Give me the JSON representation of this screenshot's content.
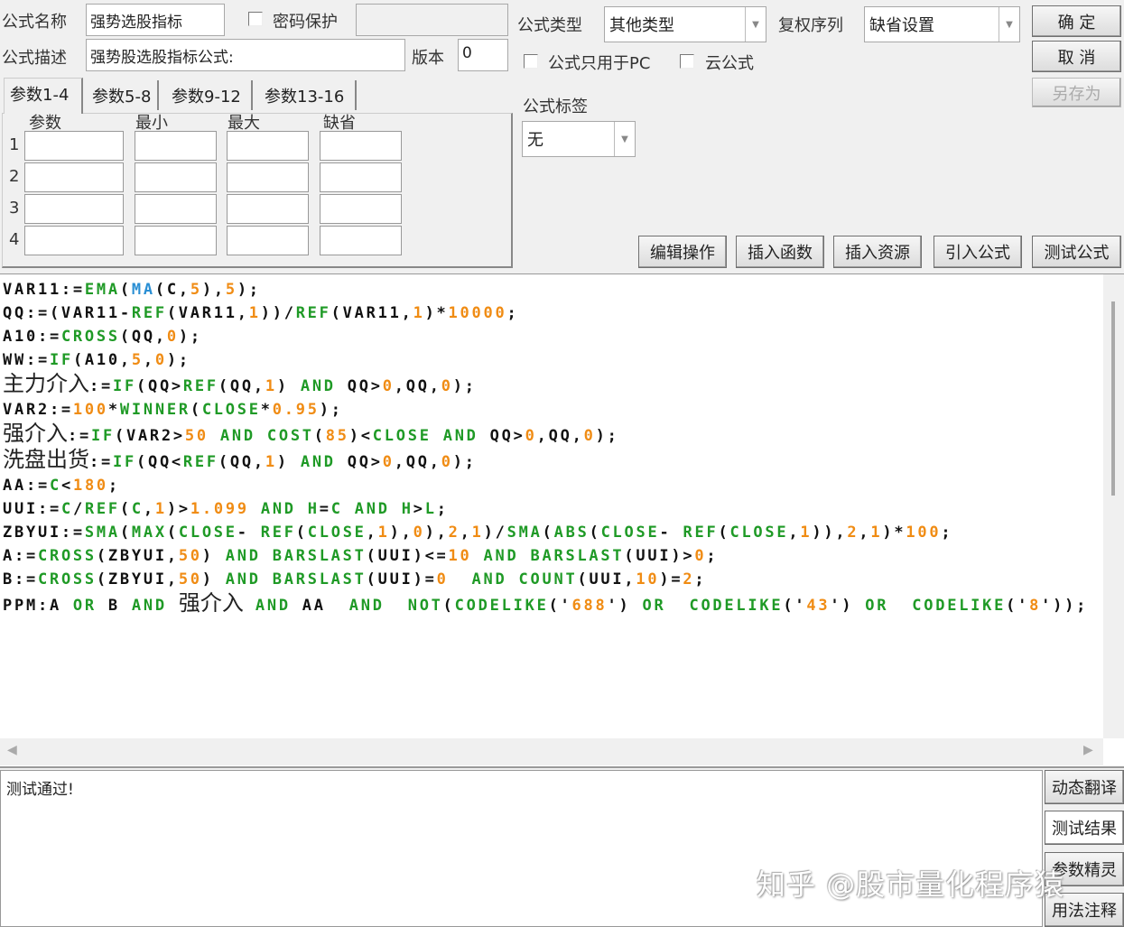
{
  "form": {
    "name_label": "公式名称",
    "name_value": "强势选股指标",
    "password_label": "密码保护",
    "desc_label": "公式描述",
    "desc_value": "强势股选股指标公式:",
    "version_label": "版本",
    "version_value": "0",
    "type_label": "公式类型",
    "type_value": "其他类型",
    "rights_label": "复权序列",
    "rights_value": "缺省设置",
    "pc_only_label": "公式只用于PC",
    "cloud_label": "云公式",
    "tag_label": "公式标签",
    "tag_value": "无"
  },
  "buttons": {
    "ok": "确 定",
    "cancel": "取 消",
    "save_as": "另存为",
    "edit": "编辑操作",
    "insert_func": "插入函数",
    "insert_res": "插入资源",
    "import": "引入公式",
    "test": "测试公式"
  },
  "tabs": [
    "参数1-4",
    "参数5-8",
    "参数9-12",
    "参数13-16"
  ],
  "params": {
    "headers": [
      "参数",
      "最小",
      "最大",
      "缺省"
    ],
    "rows": [
      "1",
      "2",
      "3",
      "4"
    ]
  },
  "code": [
    [
      [
        "VAR11:=",
        "k"
      ],
      [
        "EMA",
        "g"
      ],
      [
        "(",
        "k"
      ],
      [
        "MA",
        "b"
      ],
      [
        "(C,",
        "k"
      ],
      [
        "5",
        "o"
      ],
      [
        "),",
        "k"
      ],
      [
        "5",
        "o"
      ],
      [
        ");",
        "k"
      ]
    ],
    [
      [
        "QQ:=(VAR11-",
        "k"
      ],
      [
        "REF",
        "g"
      ],
      [
        "(VAR11,",
        "k"
      ],
      [
        "1",
        "o"
      ],
      [
        "))/",
        "k"
      ],
      [
        "REF",
        "g"
      ],
      [
        "(VAR11,",
        "k"
      ],
      [
        "1",
        "o"
      ],
      [
        ")*",
        "k"
      ],
      [
        "10000",
        "o"
      ],
      [
        ";",
        "k"
      ]
    ],
    [
      [
        "A10:=",
        "k"
      ],
      [
        "CROSS",
        "g"
      ],
      [
        "(QQ,",
        "k"
      ],
      [
        "0",
        "o"
      ],
      [
        ");",
        "k"
      ]
    ],
    [
      [
        "WW:=",
        "k"
      ],
      [
        "IF",
        "g"
      ],
      [
        "(A10,",
        "k"
      ],
      [
        "5",
        "o"
      ],
      [
        ",",
        "k"
      ],
      [
        "0",
        "o"
      ],
      [
        ");",
        "k"
      ]
    ],
    [
      [
        "主力介入",
        "z"
      ],
      [
        ":=",
        "k"
      ],
      [
        "IF",
        "g"
      ],
      [
        "(QQ>",
        "k"
      ],
      [
        "REF",
        "g"
      ],
      [
        "(QQ,",
        "k"
      ],
      [
        "1",
        "o"
      ],
      [
        ") ",
        "k"
      ],
      [
        "AND",
        "g"
      ],
      [
        " QQ>",
        "k"
      ],
      [
        "0",
        "o"
      ],
      [
        ",QQ,",
        "k"
      ],
      [
        "0",
        "o"
      ],
      [
        ");",
        "k"
      ]
    ],
    [
      [
        "VAR2:=",
        "k"
      ],
      [
        "100",
        "o"
      ],
      [
        "*",
        "k"
      ],
      [
        "WINNER",
        "g"
      ],
      [
        "(",
        "k"
      ],
      [
        "CLOSE",
        "g"
      ],
      [
        "*",
        "k"
      ],
      [
        "0.95",
        "o"
      ],
      [
        ");",
        "k"
      ]
    ],
    [
      [
        "强介入",
        "z"
      ],
      [
        ":=",
        "k"
      ],
      [
        "IF",
        "g"
      ],
      [
        "(VAR2>",
        "k"
      ],
      [
        "50",
        "o"
      ],
      [
        " ",
        "k"
      ],
      [
        "AND",
        "g"
      ],
      [
        " ",
        "k"
      ],
      [
        "COST",
        "g"
      ],
      [
        "(",
        "k"
      ],
      [
        "85",
        "o"
      ],
      [
        ")<",
        "k"
      ],
      [
        "CLOSE",
        "g"
      ],
      [
        " ",
        "k"
      ],
      [
        "AND",
        "g"
      ],
      [
        " QQ>",
        "k"
      ],
      [
        "0",
        "o"
      ],
      [
        ",QQ,",
        "k"
      ],
      [
        "0",
        "o"
      ],
      [
        ");",
        "k"
      ]
    ],
    [
      [
        "洗盘出货",
        "z"
      ],
      [
        ":=",
        "k"
      ],
      [
        "IF",
        "g"
      ],
      [
        "(QQ<",
        "k"
      ],
      [
        "REF",
        "g"
      ],
      [
        "(QQ,",
        "k"
      ],
      [
        "1",
        "o"
      ],
      [
        ") ",
        "k"
      ],
      [
        "AND",
        "g"
      ],
      [
        " QQ>",
        "k"
      ],
      [
        "0",
        "o"
      ],
      [
        ",QQ,",
        "k"
      ],
      [
        "0",
        "o"
      ],
      [
        ");",
        "k"
      ]
    ],
    [
      [
        "AA:=",
        "k"
      ],
      [
        "C",
        "g"
      ],
      [
        "<",
        "k"
      ],
      [
        "180",
        "o"
      ],
      [
        ";",
        "k"
      ]
    ],
    [
      [
        "UUI:=",
        "k"
      ],
      [
        "C",
        "g"
      ],
      [
        "/",
        "k"
      ],
      [
        "REF",
        "g"
      ],
      [
        "(",
        "k"
      ],
      [
        "C",
        "g"
      ],
      [
        ",",
        "k"
      ],
      [
        "1",
        "o"
      ],
      [
        ")>",
        "k"
      ],
      [
        "1.099",
        "o"
      ],
      [
        " ",
        "k"
      ],
      [
        "AND",
        "g"
      ],
      [
        " ",
        "k"
      ],
      [
        "H",
        "g"
      ],
      [
        "=",
        "k"
      ],
      [
        "C",
        "g"
      ],
      [
        " ",
        "k"
      ],
      [
        "AND",
        "g"
      ],
      [
        " ",
        "k"
      ],
      [
        "H",
        "g"
      ],
      [
        ">",
        "k"
      ],
      [
        "L",
        "g"
      ],
      [
        ";",
        "k"
      ]
    ],
    [
      [
        "ZBYUI:=",
        "k"
      ],
      [
        "SMA",
        "g"
      ],
      [
        "(",
        "k"
      ],
      [
        "MAX",
        "g"
      ],
      [
        "(",
        "k"
      ],
      [
        "CLOSE",
        "g"
      ],
      [
        "- ",
        "k"
      ],
      [
        "REF",
        "g"
      ],
      [
        "(",
        "k"
      ],
      [
        "CLOSE",
        "g"
      ],
      [
        ",",
        "k"
      ],
      [
        "1",
        "o"
      ],
      [
        "),",
        "k"
      ],
      [
        "0",
        "o"
      ],
      [
        "),",
        "k"
      ],
      [
        "2",
        "o"
      ],
      [
        ",",
        "k"
      ],
      [
        "1",
        "o"
      ],
      [
        ")/",
        "k"
      ],
      [
        "SMA",
        "g"
      ],
      [
        "(",
        "k"
      ],
      [
        "ABS",
        "g"
      ],
      [
        "(",
        "k"
      ],
      [
        "CLOSE",
        "g"
      ],
      [
        "- ",
        "k"
      ],
      [
        "REF",
        "g"
      ],
      [
        "(",
        "k"
      ],
      [
        "CLOSE",
        "g"
      ],
      [
        ",",
        "k"
      ],
      [
        "1",
        "o"
      ],
      [
        ")),",
        "k"
      ],
      [
        "2",
        "o"
      ],
      [
        ",",
        "k"
      ],
      [
        "1",
        "o"
      ],
      [
        ")*",
        "k"
      ],
      [
        "100",
        "o"
      ],
      [
        ";",
        "k"
      ]
    ],
    [
      [
        "A:=",
        "k"
      ],
      [
        "CROSS",
        "g"
      ],
      [
        "(ZBYUI,",
        "k"
      ],
      [
        "50",
        "o"
      ],
      [
        ") ",
        "k"
      ],
      [
        "AND",
        "g"
      ],
      [
        " ",
        "k"
      ],
      [
        "BARSLAST",
        "g"
      ],
      [
        "(UUI)<=",
        "k"
      ],
      [
        "10",
        "o"
      ],
      [
        " ",
        "k"
      ],
      [
        "AND",
        "g"
      ],
      [
        " ",
        "k"
      ],
      [
        "BARSLAST",
        "g"
      ],
      [
        "(UUI)>",
        "k"
      ],
      [
        "0",
        "o"
      ],
      [
        ";",
        "k"
      ]
    ],
    [
      [
        "B:=",
        "k"
      ],
      [
        "CROSS",
        "g"
      ],
      [
        "(ZBYUI,",
        "k"
      ],
      [
        "50",
        "o"
      ],
      [
        ") ",
        "k"
      ],
      [
        "AND",
        "g"
      ],
      [
        " ",
        "k"
      ],
      [
        "BARSLAST",
        "g"
      ],
      [
        "(UUI)=",
        "k"
      ],
      [
        "0",
        "o"
      ],
      [
        "  ",
        "k"
      ],
      [
        "AND",
        "g"
      ],
      [
        " ",
        "k"
      ],
      [
        "COUNT",
        "g"
      ],
      [
        "(UUI,",
        "k"
      ],
      [
        "10",
        "o"
      ],
      [
        ")=",
        "k"
      ],
      [
        "2",
        "o"
      ],
      [
        ";",
        "k"
      ]
    ],
    [
      [
        "PPM:A ",
        "k"
      ],
      [
        "OR",
        "g"
      ],
      [
        " B ",
        "k"
      ],
      [
        "AND",
        "g"
      ],
      [
        " ",
        "k"
      ],
      [
        "强介入",
        "z"
      ],
      [
        " ",
        "k"
      ],
      [
        "AND",
        "g"
      ],
      [
        " AA  ",
        "k"
      ],
      [
        "AND",
        "g"
      ],
      [
        "  ",
        "k"
      ],
      [
        "NOT",
        "g"
      ],
      [
        "(",
        "k"
      ],
      [
        "CODELIKE",
        "g"
      ],
      [
        "('",
        "k"
      ],
      [
        "688",
        "o"
      ],
      [
        "') ",
        "k"
      ],
      [
        "OR",
        "g"
      ],
      [
        "  ",
        "k"
      ],
      [
        "CODELIKE",
        "g"
      ],
      [
        "('",
        "k"
      ],
      [
        "43",
        "o"
      ],
      [
        "') ",
        "k"
      ],
      [
        "OR",
        "g"
      ],
      [
        "  ",
        "k"
      ],
      [
        "CODELIKE",
        "g"
      ],
      [
        "('",
        "k"
      ],
      [
        "8",
        "o"
      ],
      [
        "'));",
        "k"
      ]
    ]
  ],
  "output": {
    "text": "测试通过!"
  },
  "side_buttons": [
    "动态翻译",
    "测试结果",
    "参数精灵",
    "用法注释"
  ],
  "watermark": "知乎 @股市量化程序猿",
  "colors": {
    "keyword": "#1f9a26",
    "number": "#f08c14",
    "builtin": "#2a8fd4"
  }
}
